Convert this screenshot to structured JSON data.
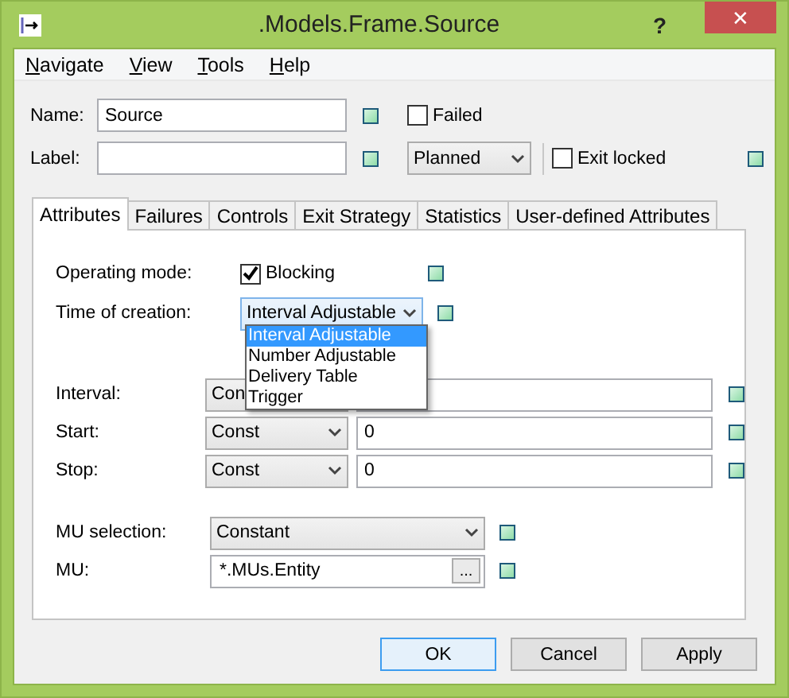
{
  "window": {
    "title": ".Models.Frame.Source",
    "help": "?",
    "close": "✕"
  },
  "menu": [
    {
      "mnemonic": "N",
      "rest": "avigate"
    },
    {
      "mnemonic": "V",
      "rest": "iew"
    },
    {
      "mnemonic": "T",
      "rest": "ools"
    },
    {
      "mnemonic": "H",
      "rest": "elp"
    }
  ],
  "name": {
    "label": "Name:",
    "value": "Source"
  },
  "label_field": {
    "label": "Label:"
  },
  "failed": {
    "label": "Failed",
    "checked": false
  },
  "state_select": {
    "value": "Planned"
  },
  "exit_locked": {
    "label": "Exit locked",
    "checked": false
  },
  "tabs": [
    {
      "label": "Attributes",
      "selected": true
    },
    {
      "label": "Failures",
      "selected": false
    },
    {
      "label": "Controls",
      "selected": false
    },
    {
      "label": "Exit Strategy",
      "selected": false
    },
    {
      "label": "Statistics",
      "selected": false
    },
    {
      "label": "User-defined Attributes",
      "selected": false
    }
  ],
  "operating_mode": {
    "label": "Operating mode:",
    "option": "Blocking",
    "checked": true
  },
  "time_of_creation": {
    "label": "Time of creation:",
    "value": "Interval Adjustable",
    "expanded": true,
    "options": [
      {
        "label": "Interval Adjustable",
        "selected": true
      },
      {
        "label": "Number Adjustable",
        "selected": false
      },
      {
        "label": "Delivery Table",
        "selected": false
      },
      {
        "label": "Trigger",
        "selected": false
      }
    ]
  },
  "timing": [
    {
      "label": "Interval:",
      "type": "Con"
    },
    {
      "label": "Start:",
      "type": "Const",
      "value": "0"
    },
    {
      "label": "Stop:",
      "type": "Const",
      "value": "0"
    }
  ],
  "mu_selection": {
    "label": "MU selection:",
    "value": "Constant"
  },
  "mu": {
    "label": "MU:",
    "value": "*.MUs.Entity",
    "browse": "..."
  },
  "buttons": [
    {
      "label": "OK",
      "default": true
    },
    {
      "label": "Cancel",
      "default": false
    },
    {
      "label": "Apply",
      "default": false
    }
  ]
}
